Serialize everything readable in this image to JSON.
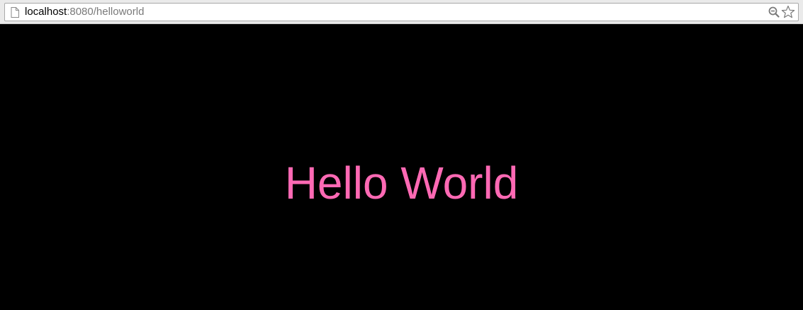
{
  "browser": {
    "url_host": "localhost",
    "url_rest": ":8080/helloworld",
    "page_icon": "page-icon",
    "zoom_icon": "magnifier-minus-icon",
    "bookmark_icon": "star-icon"
  },
  "page": {
    "heading": "Hello World",
    "heading_color": "#ff69b4",
    "background_color": "#000000"
  }
}
